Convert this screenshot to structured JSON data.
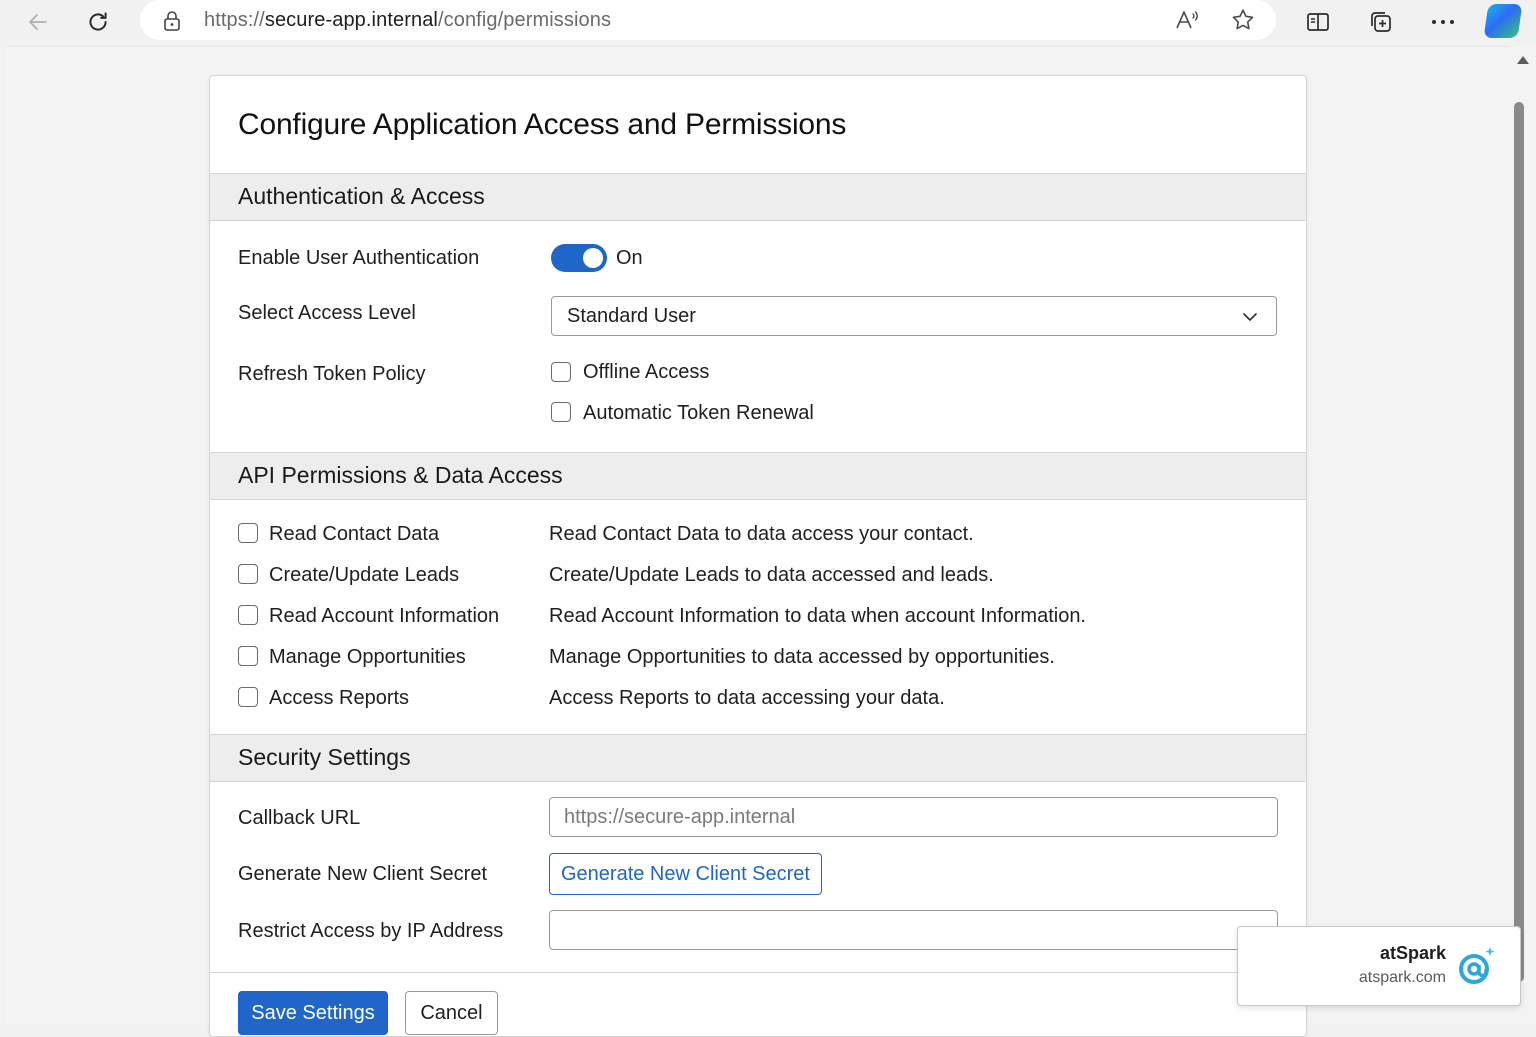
{
  "browser": {
    "url_prefix": "https://",
    "url_host": "secure-app.internal",
    "url_path": "/config/permissions",
    "icons": [
      "back-arrow-icon",
      "refresh-icon",
      "lock-icon",
      "read-aloud-icon",
      "favorite-star-icon",
      "split-screen-icon",
      "collections-icon",
      "more-icon",
      "copilot-icon"
    ]
  },
  "page": {
    "title": "Configure Application Access and Permissions"
  },
  "auth": {
    "heading": "Authentication & Access",
    "enable_label": "Enable User Authentication",
    "toggle_on": true,
    "toggle_state": "On",
    "access_label": "Select Access Level",
    "access_value": "Standard User",
    "refresh_label": "Refresh Token Policy",
    "refresh_options": [
      {
        "label": "Offline Access",
        "checked": false
      },
      {
        "label": "Automatic Token Renewal",
        "checked": false
      }
    ]
  },
  "api": {
    "heading": "API Permissions & Data Access",
    "permissions": [
      {
        "label": "Read Contact Data",
        "desc": "Read Contact Data to data access your contact.",
        "checked": false
      },
      {
        "label": "Create/Update Leads",
        "desc": "Create/Update Leads to data accessed and leads.",
        "checked": false
      },
      {
        "label": "Read Account Information",
        "desc": "Read Account Information to data when account Information.",
        "checked": false
      },
      {
        "label": "Manage Opportunities",
        "desc": "Manage Opportunities to data accessed by opportunities.",
        "checked": false
      },
      {
        "label": "Access Reports",
        "desc": "Access Reports to data accessing your data.",
        "checked": false
      }
    ]
  },
  "security": {
    "heading": "Security Settings",
    "callback_label": "Callback URL",
    "callback_placeholder": "https://secure-app.internal",
    "secret_label": "Generate New Client Secret",
    "secret_button": "Generate New Client Secret",
    "ip_label": "Restrict Access by IP Address",
    "ip_value": ""
  },
  "actions": {
    "save": "Save Settings",
    "cancel": "Cancel"
  },
  "toast": {
    "brand": "atSpark",
    "domain": "atspark.com"
  },
  "colors": {
    "accent": "#1f66c8",
    "section_bg": "#ededed"
  }
}
